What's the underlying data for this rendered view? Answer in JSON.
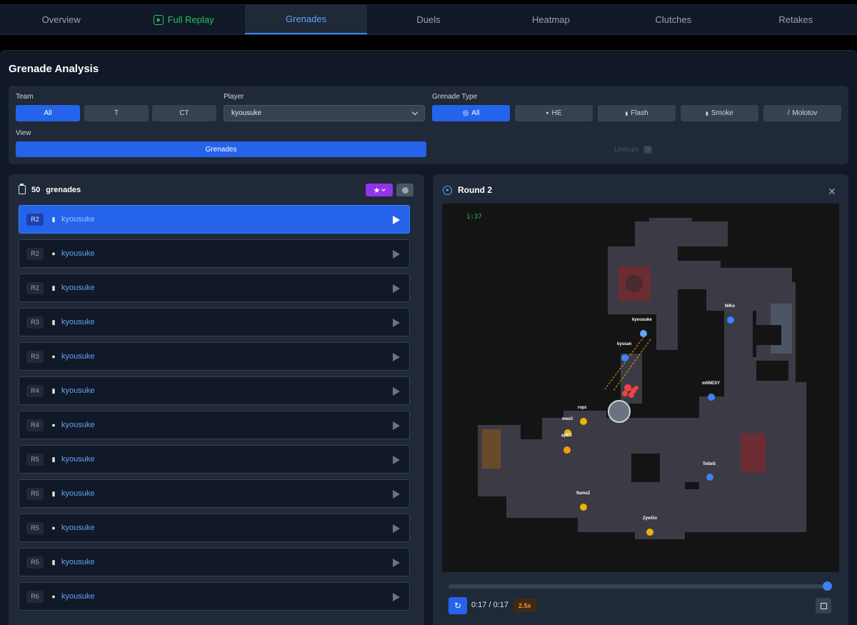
{
  "tabs": [
    {
      "label": "Overview"
    },
    {
      "label": "Full Replay"
    },
    {
      "label": "Grenades"
    },
    {
      "label": "Duels"
    },
    {
      "label": "Heatmap"
    },
    {
      "label": "Clutches"
    },
    {
      "label": "Retakes"
    }
  ],
  "active_tab": "Grenades",
  "page_title": "Grenade Analysis",
  "filters": {
    "team_label": "Team",
    "team_options": [
      "All",
      "T",
      "CT"
    ],
    "team_selected": "All",
    "player_label": "Player",
    "player_value": "kyousuke",
    "grenade_type_label": "Grenade Type",
    "grenade_types": [
      "All",
      "HE",
      "Flash",
      "Smoke",
      "Molotov"
    ],
    "grenade_icons": [
      "◎",
      "●",
      "▮",
      "▮",
      "/"
    ],
    "grenade_selected": "All",
    "view_label": "View",
    "view_options": [
      "Grenades",
      "Lineups"
    ],
    "view_selected": "Grenades",
    "lineups_count": "0"
  },
  "list": {
    "count": "50",
    "count_label": "grenades",
    "items": [
      {
        "round": "R2",
        "type_icon": "▮",
        "player": "kyousuke",
        "active": true
      },
      {
        "round": "R2",
        "type_icon": "●",
        "player": "kyousuke"
      },
      {
        "round": "R2",
        "type_icon": "▮",
        "player": "kyousuke"
      },
      {
        "round": "R3",
        "type_icon": "▮",
        "player": "kyousuke"
      },
      {
        "round": "R3",
        "type_icon": "●",
        "player": "kyousuke"
      },
      {
        "round": "R4",
        "type_icon": "▮",
        "player": "kyousuke"
      },
      {
        "round": "R4",
        "type_icon": "●",
        "player": "kyousuke"
      },
      {
        "round": "R5",
        "type_icon": "▮",
        "player": "kyousuke"
      },
      {
        "round": "R5",
        "type_icon": "▮",
        "player": "kyousuke"
      },
      {
        "round": "R5",
        "type_icon": "●",
        "player": "kyousuke"
      },
      {
        "round": "R5",
        "type_icon": "▮",
        "player": "kyousuke"
      },
      {
        "round": "R6",
        "type_icon": "●",
        "player": "kyousuke"
      }
    ]
  },
  "replay": {
    "title": "Round 2",
    "map_timer": "1:37",
    "time": "0:17 / 0:17",
    "speed": "2.5x",
    "progress": 1.0,
    "players": [
      {
        "name": "kyousuke",
        "team": "CT"
      },
      {
        "name": "NiKo",
        "team": "CT"
      },
      {
        "name": "kyssan",
        "team": "CT"
      },
      {
        "name": "m0NESY",
        "team": "CT"
      },
      {
        "name": "ropz",
        "team": "T"
      },
      {
        "name": "mezii",
        "team": "T"
      },
      {
        "name": "apEX",
        "team": "T"
      },
      {
        "name": "TeSeS",
        "team": "CT"
      },
      {
        "name": "flameZ",
        "team": "T"
      },
      {
        "name": "ZywOo",
        "team": "T"
      }
    ]
  },
  "colors": {
    "accent": "#2563eb",
    "ct": "#3b82f6",
    "t": "#eab308",
    "replay_green": "#22c55e",
    "favorite": "#9333ea"
  }
}
